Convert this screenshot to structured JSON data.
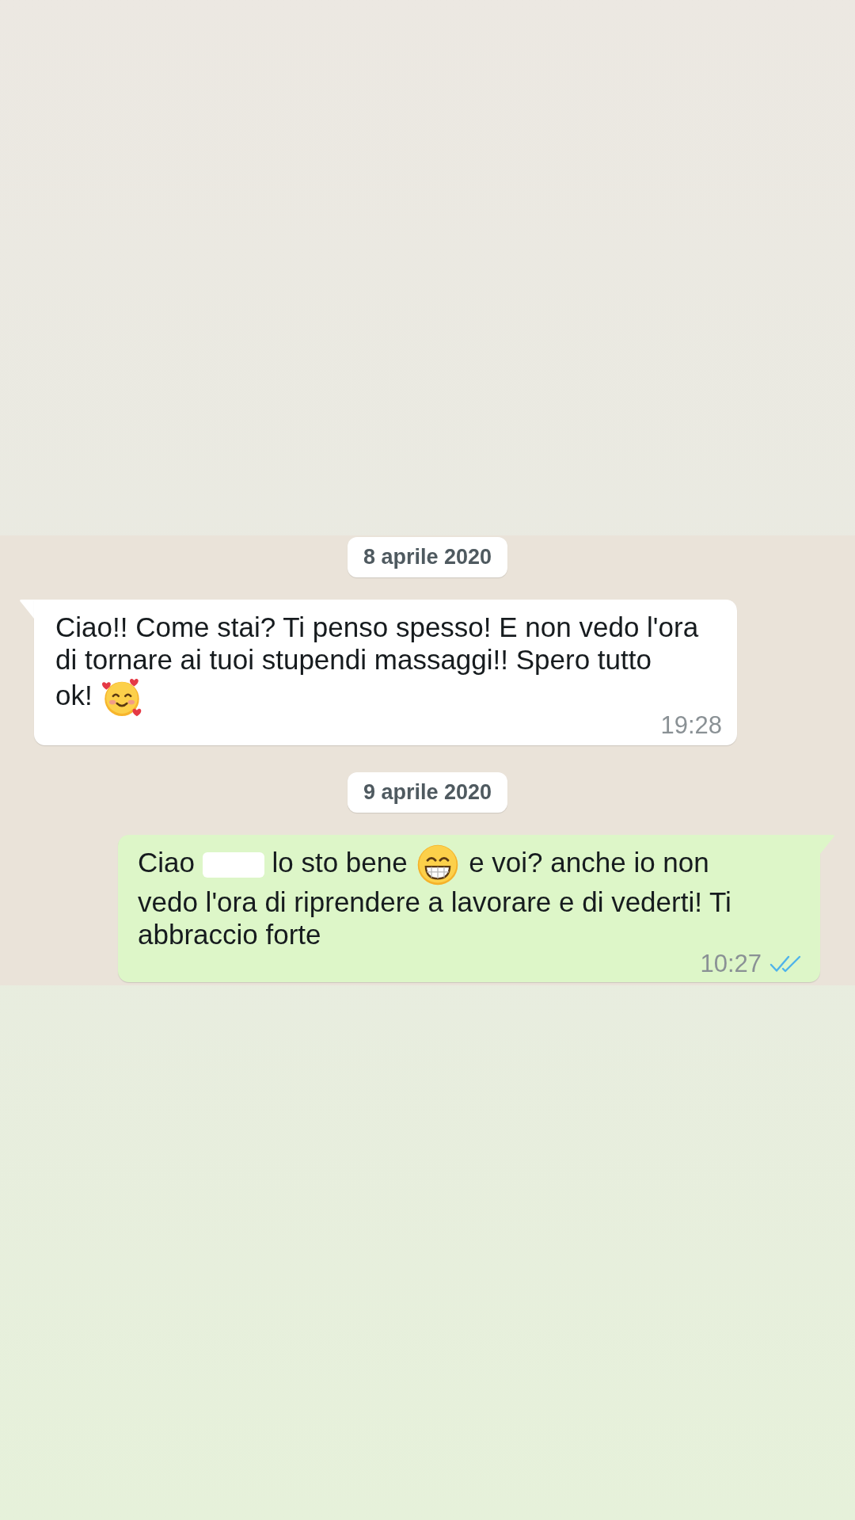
{
  "chat": {
    "items": [
      {
        "kind": "date",
        "text": "8 aprile 2020"
      },
      {
        "kind": "incoming_message",
        "parts": [
          {
            "kind": "text",
            "text": "Ciao!! Come stai? Ti penso spesso! E non vedo l'ora di tornare ai tuoi stupendi massaggi!! Spero tutto"
          },
          {
            "kind": "text",
            "text": "ok!"
          },
          {
            "kind": "hearts_emoji"
          }
        ],
        "time": "19:28"
      },
      {
        "kind": "date",
        "text": "9 aprile 2020"
      },
      {
        "kind": "outgoing_message",
        "parts": [
          {
            "kind": "text",
            "text": "Ciao"
          },
          {
            "kind": "redaction"
          },
          {
            "kind": "text",
            "text": "lo sto bene"
          },
          {
            "kind": "grin_emoji"
          },
          {
            "kind": "text",
            "text": "e voi? anche io non"
          },
          {
            "kind": "text",
            "text": "vedo l'ora di riprendere a lavorare e di vederti! Ti abbraccio forte"
          }
        ],
        "time": "10:27",
        "read": true
      }
    ]
  }
}
